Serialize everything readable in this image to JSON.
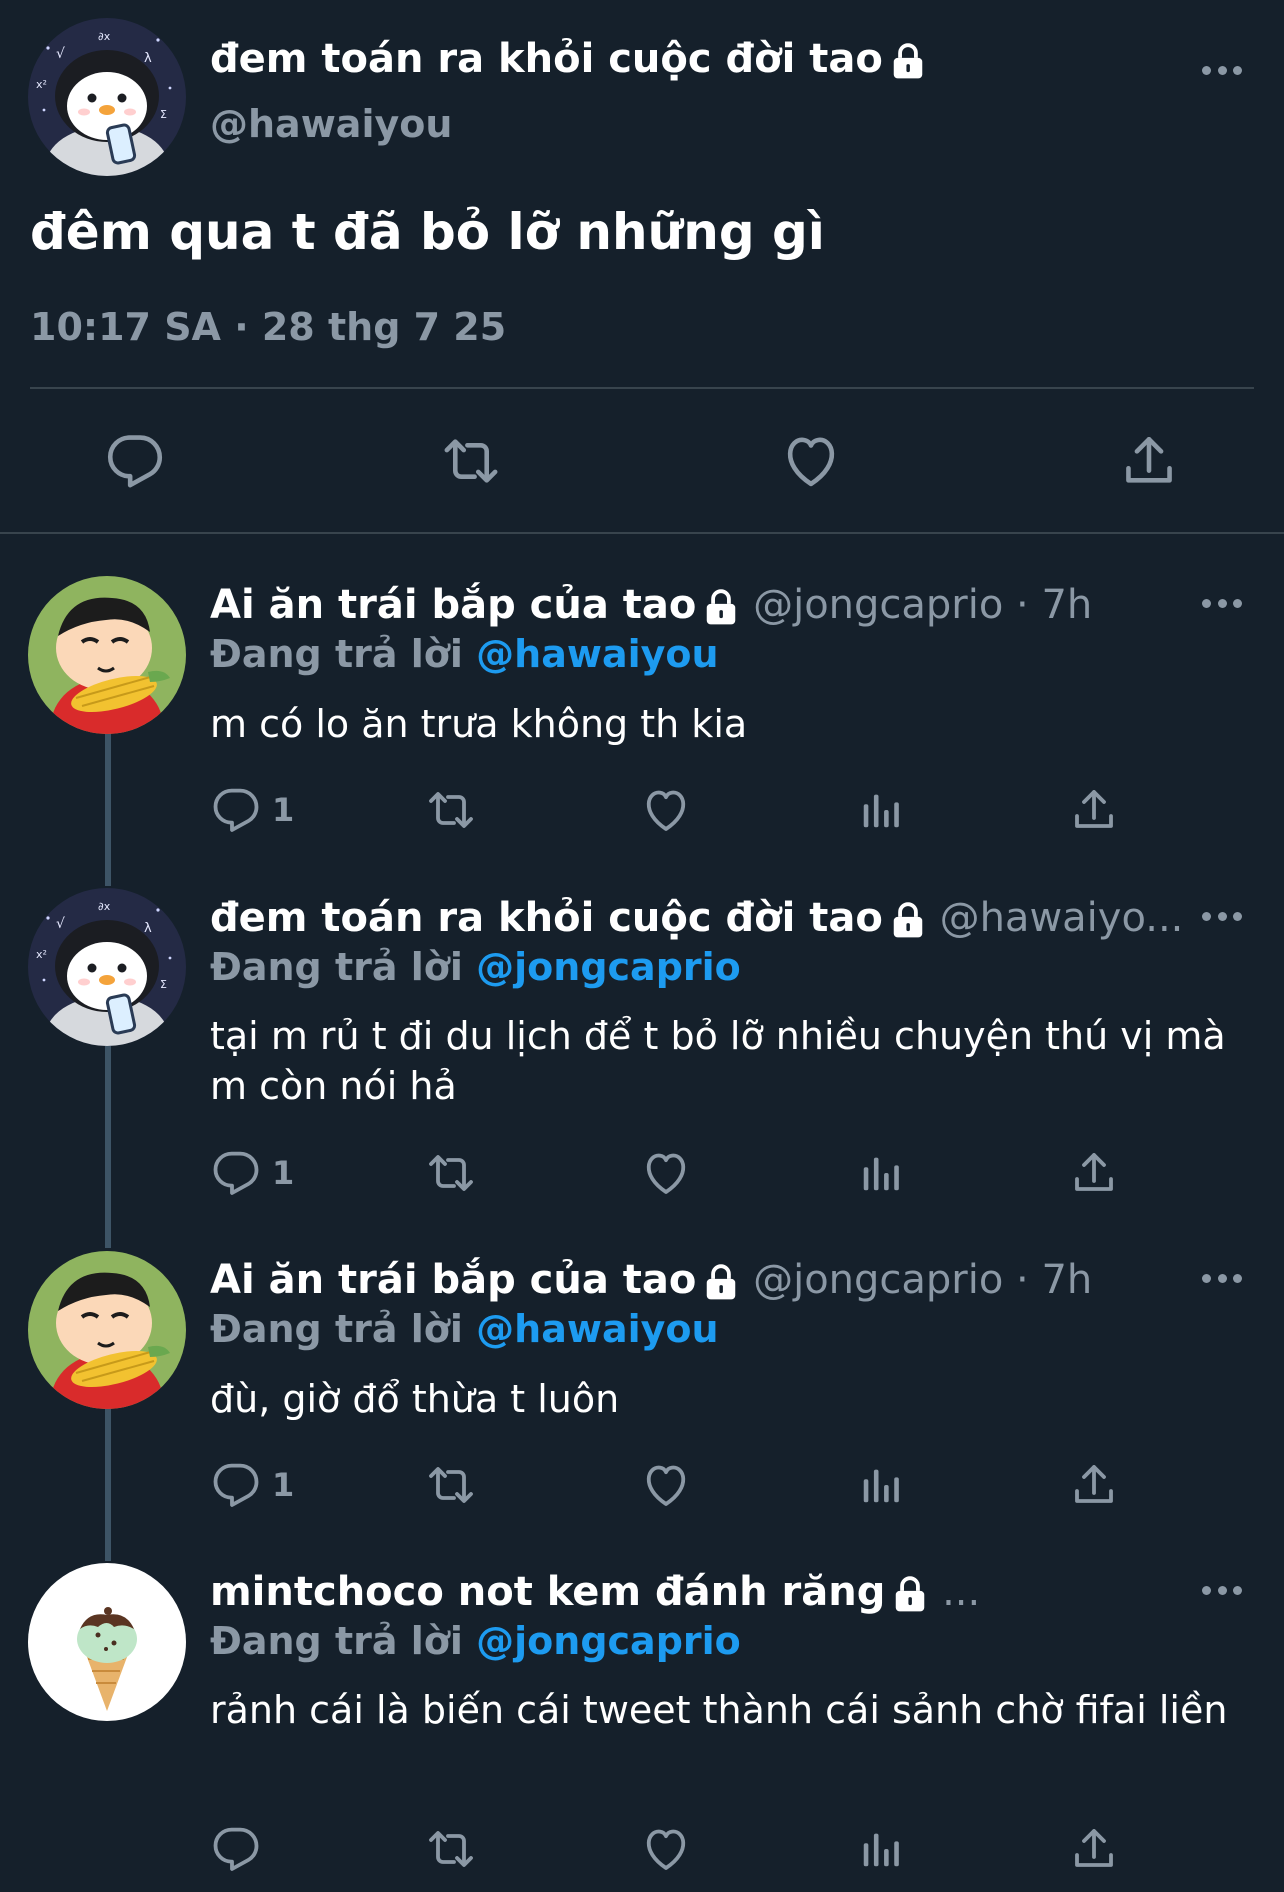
{
  "main_tweet": {
    "display_name": "đem toán ra khỏi cuộc đời tao",
    "handle": "@hawaiyou",
    "text": "đêm qua t đã bỏ lỡ những gì",
    "timestamp": "10:17 SA · 28 thg 7 25"
  },
  "replies": [
    {
      "display_name": "Ai ăn trái bắp của tao",
      "meta": "@jongcaprio · 7h",
      "replying_label": "Đang trả lời",
      "replying_to": "@hawaiyou",
      "text": "m có lo ăn trưa không th kia",
      "reply_count": "1"
    },
    {
      "display_name": "đem toán ra khỏi cuộc đời tao",
      "meta": "@hawaiyo...",
      "replying_label": "Đang trả lời",
      "replying_to": "@jongcaprio",
      "text": "tại m rủ t đi du lịch để t bỏ lỡ nhiều chuyện thú vị mà m còn nói hả",
      "reply_count": "1"
    },
    {
      "display_name": "Ai ăn trái bắp của tao",
      "meta": "@jongcaprio · 7h",
      "replying_label": "Đang trả lời",
      "replying_to": "@hawaiyou",
      "text": "đù, giờ đổ thừa t luôn",
      "reply_count": "1"
    },
    {
      "display_name": "mintchoco not kem đánh răng",
      "meta": "...",
      "replying_label": "Đang trả lời",
      "replying_to": "@jongcaprio",
      "text": "rảnh cái là biến cái tweet thành cái sảnh chờ fifai liền",
      "reply_count": ""
    }
  ],
  "colors": {
    "background": "#15202b",
    "text": "#ffffff",
    "secondary": "#8b98a5",
    "accent": "#1d9bf0",
    "divider": "#38444d"
  },
  "icons": {
    "reply": "speech-bubble-icon",
    "retweet": "retweet-arrows-icon",
    "like": "heart-icon",
    "share": "share-upload-icon",
    "views": "bar-chart-icon",
    "more": "ellipsis-icon",
    "protected": "lock-icon"
  }
}
